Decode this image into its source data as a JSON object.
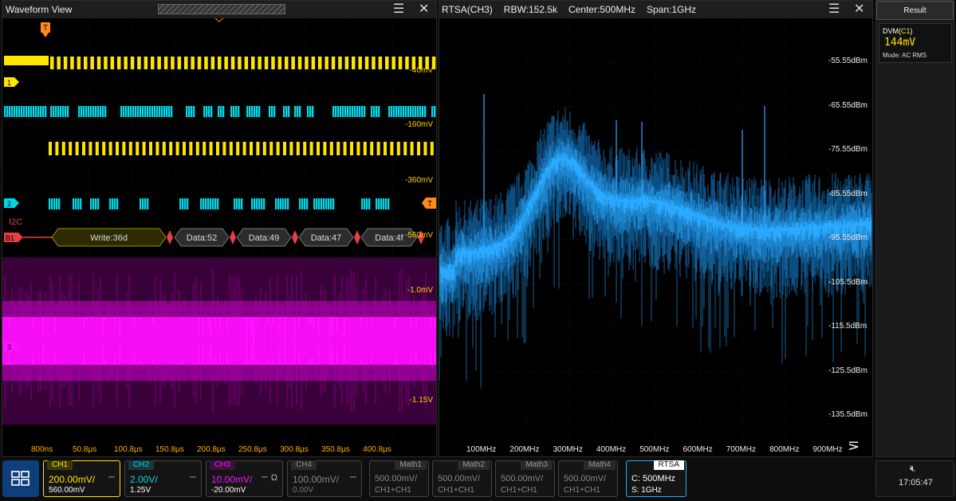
{
  "waveform": {
    "title": "Waveform View",
    "ch_labels": [
      "1",
      "2",
      "3",
      "B1"
    ],
    "bus_name": "I2C",
    "voltage_labels": [
      "-40mV",
      "-160mV",
      "-360mV",
      "-560mV",
      "-1.0mV",
      "-1.15V"
    ],
    "decode": [
      "Write:36d",
      "Data:52",
      "Data:49",
      "Data:47",
      "Data:4f"
    ],
    "time_ticks": [
      "800ns",
      "50.8µs",
      "100.8µs",
      "150.8µs",
      "200.8µs",
      "250.8µs",
      "300.8µs",
      "350.8µs",
      "400.8µs"
    ],
    "trigger_icon": "T",
    "colors": {
      "ch1": "#ffe600",
      "ch2": "#00d8e8",
      "ch3": "#ff10ff",
      "bus": "#e84040"
    }
  },
  "rtsa": {
    "title": "RTSA(CH3)",
    "rbw": "RBW:152.5k",
    "center": "Center:500MHz",
    "span": "Span:1GHz",
    "db_ticks": [
      "-55.55dBm",
      "-65.55dBm",
      "-75.55dBm",
      "-85.55dBm",
      "-95.55dBm",
      "-105.5dBm",
      "-115.5dBm",
      "-125.5dBm",
      "-135.5dBm"
    ],
    "freq_ticks": [
      "100MHz",
      "200MHz",
      "300MHz",
      "400MHz",
      "500MHz",
      "600MHz",
      "700MHz",
      "800MHz",
      "900MHz"
    ],
    "color": "#2aa9ff"
  },
  "result": {
    "title": "Result",
    "dvm_label": "DVM(",
    "dvm_ch": "C1",
    "dvm_close": ")",
    "value": "144mV",
    "mode": "Mode: AC RMS"
  },
  "bottom": {
    "ch1": {
      "name": "CH1",
      "scale": "200.00mV/",
      "offset": "560.00mV"
    },
    "ch2": {
      "name": "CH2",
      "scale": "2.00V/",
      "offset": "1.25V"
    },
    "ch3": {
      "name": "CH3",
      "scale": "10.00mV/",
      "offset": "-20.00mV",
      "imp": "Ω"
    },
    "ch4": {
      "name": "CH4",
      "scale": "100.00mV/",
      "offset": "0.00V"
    },
    "math": [
      {
        "name": "Math1",
        "scale": "500.00mV/",
        "expr": "CH1+CH1"
      },
      {
        "name": "Math2",
        "scale": "500.00mV/",
        "expr": "CH1+CH1"
      },
      {
        "name": "Math3",
        "scale": "500.00mV/",
        "expr": "CH1+CH1"
      },
      {
        "name": "Math4",
        "scale": "500.00mV/",
        "expr": "CH1+CH1"
      }
    ],
    "rtsa": {
      "name": "RTSA",
      "center": "C: 500MHz",
      "span": "S: 1GHz"
    },
    "clock": "17:05:47"
  }
}
